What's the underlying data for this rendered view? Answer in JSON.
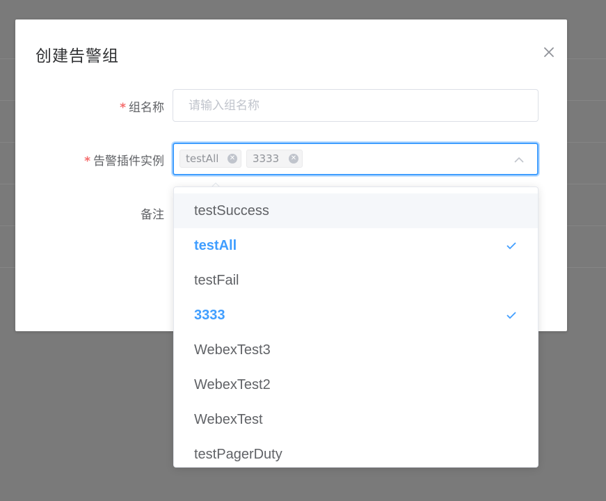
{
  "dialog": {
    "title": "创建告警组",
    "close_icon": "close-icon"
  },
  "form": {
    "group_name": {
      "label": "组名称",
      "required_mark": "*",
      "placeholder": "请输入组名称",
      "value": ""
    },
    "plugin_instances": {
      "label": "告警插件实例",
      "required_mark": "*",
      "tags": [
        {
          "label": "testAll"
        },
        {
          "label": "3333"
        }
      ],
      "arrow_icon": "chevron-up-icon"
    },
    "remark": {
      "label": "备注"
    }
  },
  "dropdown": {
    "options": [
      {
        "label": "testSuccess",
        "selected": false,
        "hover": true
      },
      {
        "label": "testAll",
        "selected": true,
        "hover": false
      },
      {
        "label": "testFail",
        "selected": false,
        "hover": false
      },
      {
        "label": "3333",
        "selected": true,
        "hover": false
      },
      {
        "label": "WebexTest3",
        "selected": false,
        "hover": false
      },
      {
        "label": "WebexTest2",
        "selected": false,
        "hover": false
      },
      {
        "label": "WebexTest",
        "selected": false,
        "hover": false
      },
      {
        "label": "testPagerDuty",
        "selected": false,
        "hover": false
      }
    ],
    "check_icon": "check-icon"
  },
  "colors": {
    "accent": "#409eff",
    "required": "#f56c6c",
    "overlay": "#7a7a7a"
  }
}
